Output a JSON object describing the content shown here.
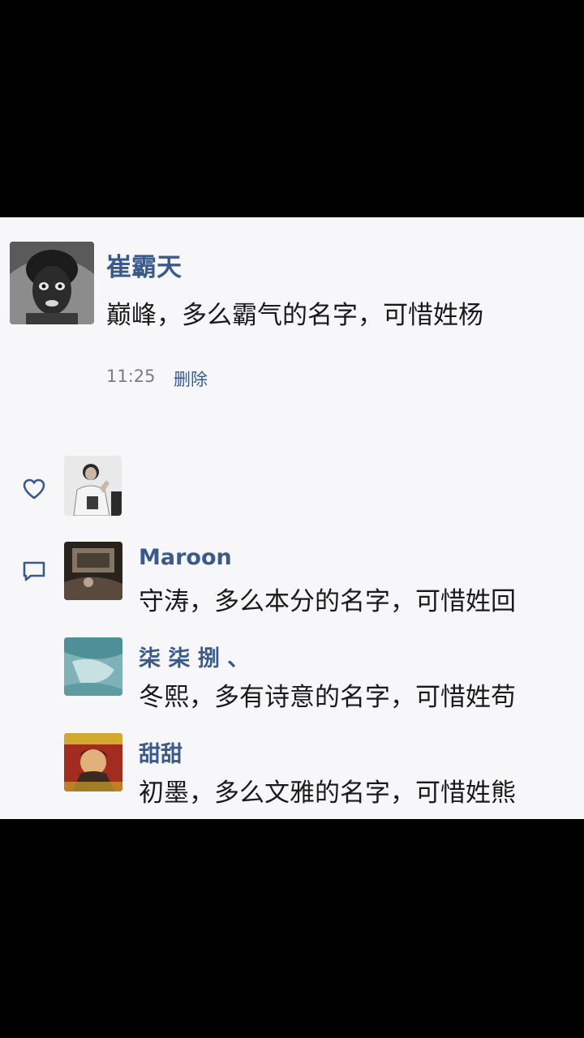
{
  "post": {
    "author": "崔霸天",
    "text": "巅峰，多么霸气的名字，可惜姓杨",
    "time": "11:25",
    "delete_label": "删除"
  },
  "likes": {
    "icon": "heart-icon"
  },
  "comments_section": {
    "icon": "comment-icon"
  },
  "comments": [
    {
      "name": "Maroon",
      "text": "守涛，多么本分的名字，可惜姓回"
    },
    {
      "name": "柒 柒 捌 、",
      "text": "冬熙，多有诗意的名字，可惜姓苟"
    },
    {
      "name": "甜甜",
      "text": "初墨，多么文雅的名字，可惜姓熊"
    }
  ],
  "colors": {
    "name_blue": "#3b5a8c",
    "text": "#1a1a1a",
    "time_gray": "#7d7d7d",
    "panel_bg": "#f7f7f9",
    "letterbox": "#000000"
  }
}
